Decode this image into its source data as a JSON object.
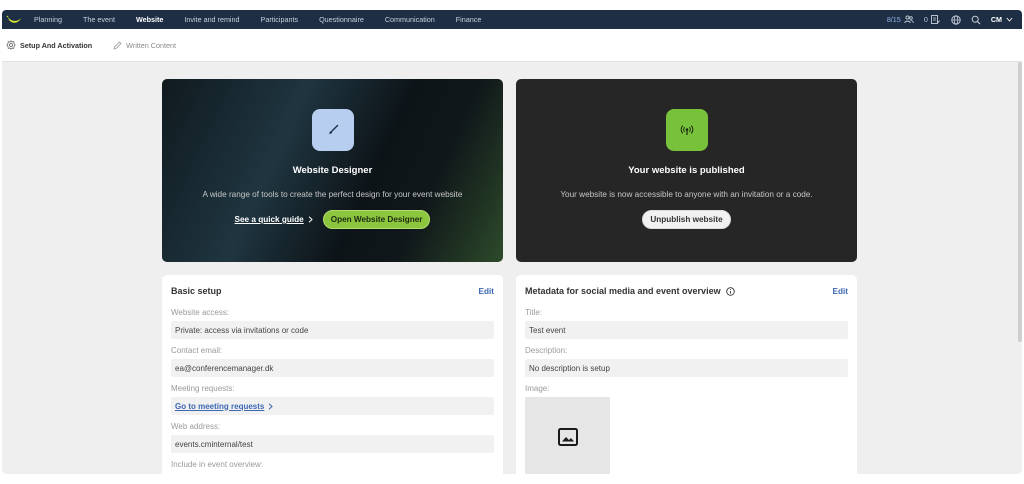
{
  "nav": {
    "items": [
      {
        "label": "Planning",
        "active": false
      },
      {
        "label": "The event",
        "active": false
      },
      {
        "label": "Website",
        "active": true
      },
      {
        "label": "Invite and remind",
        "active": false
      },
      {
        "label": "Participants",
        "active": false
      },
      {
        "label": "Questionnaire",
        "active": false
      },
      {
        "label": "Communication",
        "active": false
      },
      {
        "label": "Finance",
        "active": false
      }
    ],
    "participants_count": "8/15",
    "tasks_count": "0",
    "user_initials": "CM"
  },
  "subnav": {
    "setup": "Setup And Activation",
    "written": "Written Content"
  },
  "designer": {
    "title": "Website Designer",
    "description": "A wide range of tools to create the perfect design for your event website",
    "guide_link": "See a quick guide",
    "open_button": "Open Website Designer"
  },
  "published": {
    "title": "Your website is published",
    "description": "Your website is now accessible to anyone with an invitation or a code.",
    "unpublish_button": "Unpublish website"
  },
  "basic_setup": {
    "title": "Basic setup",
    "edit": "Edit",
    "access_label": "Website access:",
    "access_value": "Private: access via invitations or code",
    "email_label": "Contact email:",
    "email_value": "ea@conferencemanager.dk",
    "meeting_label": "Meeting requests:",
    "meeting_link": "Go to meeting requests",
    "address_label": "Web address:",
    "address_value": "events.cminternal/test",
    "overview_label": "Include in event overview:"
  },
  "metadata": {
    "title": "Metadata for social media and event overview",
    "edit": "Edit",
    "title_label": "Title:",
    "title_value": "Test event",
    "desc_label": "Description:",
    "desc_value": "No description is setup",
    "image_label": "Image:"
  },
  "colors": {
    "nav_bg": "#1e2e45",
    "accent_green": "#8cc63f",
    "link_blue": "#3c67b3"
  }
}
